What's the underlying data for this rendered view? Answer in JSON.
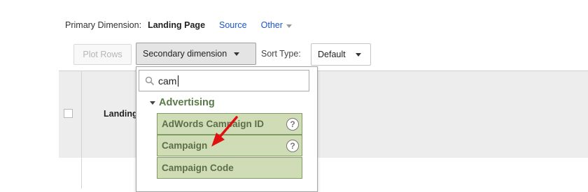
{
  "primary_dimension": {
    "label": "Primary Dimension:",
    "active": "Landing Page",
    "options": [
      "Source",
      "Other"
    ]
  },
  "toolbar": {
    "plot_rows": "Plot Rows",
    "secondary_dimension": "Secondary dimension",
    "sort_type_label": "Sort Type:",
    "sort_type_value": "Default"
  },
  "table": {
    "column_header": "Landing Page"
  },
  "dropdown": {
    "search_value": "cam",
    "group": "Advertising",
    "items": [
      {
        "label": "AdWords Campaign ID",
        "help": "?"
      },
      {
        "label": "Campaign",
        "help": "?"
      },
      {
        "label": "Campaign Code"
      }
    ]
  },
  "colors": {
    "link": "#1a56c8",
    "group_header": "#5a7a48",
    "option_bg": "#d0dcb5",
    "option_border": "#7f9a63",
    "arrow": "#e01010"
  },
  "icons": {
    "search": "search-icon",
    "help": "help-icon",
    "annotation": "red-arrow-icon"
  }
}
